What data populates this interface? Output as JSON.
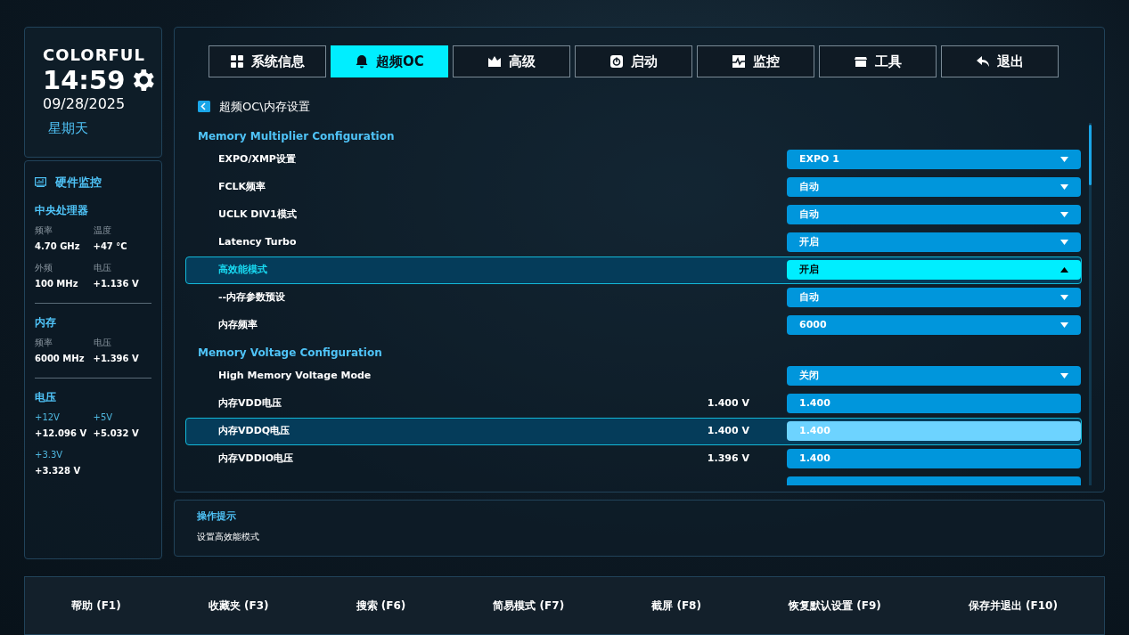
{
  "brand": {
    "logo": "COLORFUL",
    "time": "14:59",
    "date": "09/28/2025",
    "weekday": "星期天"
  },
  "monitor": {
    "title": "硬件监控",
    "groups": [
      {
        "title": "中央处理器",
        "items": [
          {
            "label": "频率",
            "value": "4.70 GHz"
          },
          {
            "label": "温度",
            "value": "+47 °C"
          },
          {
            "label": "外频",
            "value": "100 MHz"
          },
          {
            "label": "电压",
            "value": "+1.136 V"
          }
        ]
      },
      {
        "title": "内存",
        "items": [
          {
            "label": "频率",
            "value": "6000 MHz"
          },
          {
            "label": "电压",
            "value": "+1.396 V"
          }
        ]
      },
      {
        "title": "电压",
        "items": [
          {
            "label": "+12V",
            "value": "+12.096 V"
          },
          {
            "label": "+5V",
            "value": "+5.032 V"
          },
          {
            "label": "+3.3V",
            "value": "+3.328 V"
          }
        ]
      }
    ]
  },
  "tabs": [
    {
      "label": "系统信息",
      "kind": "grid",
      "selected": false
    },
    {
      "label": "超频OC",
      "kind": "bell",
      "selected": true
    },
    {
      "label": "高级",
      "kind": "crown",
      "selected": false
    },
    {
      "label": "启动",
      "kind": "power",
      "selected": false
    },
    {
      "label": "监控",
      "kind": "pulse",
      "selected": false
    },
    {
      "label": "工具",
      "kind": "box",
      "selected": false
    },
    {
      "label": "退出",
      "kind": "back",
      "selected": false
    }
  ],
  "breadcrumb": "超频OC\\内存设置",
  "sections": [
    {
      "title": "Memory Multiplier Configuration",
      "rows": [
        {
          "kind": "dropdown",
          "label": "EXPO/XMP设置",
          "value": "EXPO 1",
          "selected": false,
          "expanded": false
        },
        {
          "kind": "dropdown",
          "label": "FCLK频率",
          "value": "自动",
          "selected": false,
          "expanded": false
        },
        {
          "kind": "dropdown",
          "label": "UCLK DIV1模式",
          "value": "自动",
          "selected": false,
          "expanded": false
        },
        {
          "kind": "dropdown",
          "label": "Latency Turbo",
          "value": "开启",
          "selected": false,
          "expanded": false
        },
        {
          "kind": "dropdown",
          "label": "高效能模式",
          "value": "开启",
          "selected": true,
          "expanded": true
        },
        {
          "kind": "dropdown",
          "label": "--内存参数预设",
          "value": "自动",
          "selected": false,
          "expanded": false
        },
        {
          "kind": "dropdown",
          "label": "内存频率",
          "value": "6000",
          "selected": false,
          "expanded": false
        }
      ]
    },
    {
      "title": "Memory Voltage Configuration",
      "rows": [
        {
          "kind": "dropdown",
          "label": "High Memory Voltage Mode",
          "value": "关闭",
          "selected": false,
          "expanded": false
        },
        {
          "kind": "field",
          "label": "内存VDD电压",
          "reading": "1.400 V",
          "value": "1.400",
          "selected": false
        },
        {
          "kind": "field",
          "label": "内存VDDQ电压",
          "reading": "1.400 V",
          "value": "1.400",
          "selected": true
        },
        {
          "kind": "field",
          "label": "内存VDDIO电压",
          "reading": "1.396 V",
          "value": "1.400",
          "selected": false
        },
        {
          "kind": "field",
          "selected": false
        }
      ]
    }
  ],
  "hint": {
    "title": "操作提示",
    "text": "设置高效能模式"
  },
  "footer": [
    "帮助 (F1)",
    "收藏夹 (F3)",
    "搜索 (F6)",
    "简易模式 (F7)",
    "截屏 (F8)",
    "恢复默认设置 (F9)",
    "保存并退出 (F10)"
  ]
}
